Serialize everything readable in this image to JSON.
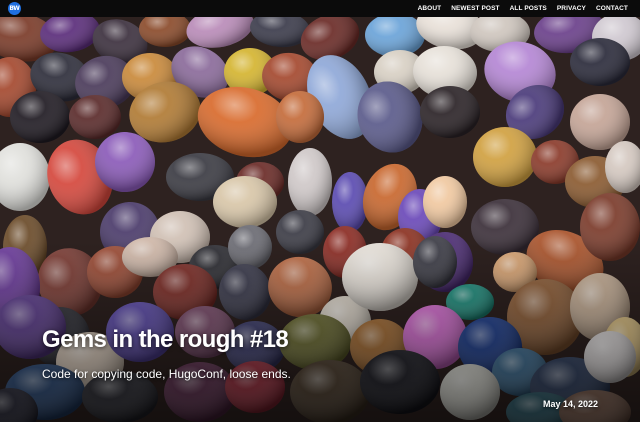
{
  "site": {
    "logo_icon": "site-logo-icon",
    "logo_text": "BW",
    "brand_color": "#1f6fe0"
  },
  "nav": {
    "items": [
      {
        "label": "About"
      },
      {
        "label": "Newest post"
      },
      {
        "label": "All posts"
      },
      {
        "label": "Privacy"
      },
      {
        "label": "Contact"
      }
    ]
  },
  "post": {
    "title": "Gems in the rough #18",
    "subtitle": "Code for copying code, HugoConf, loose ends.",
    "date": "May 14, 2022"
  }
}
